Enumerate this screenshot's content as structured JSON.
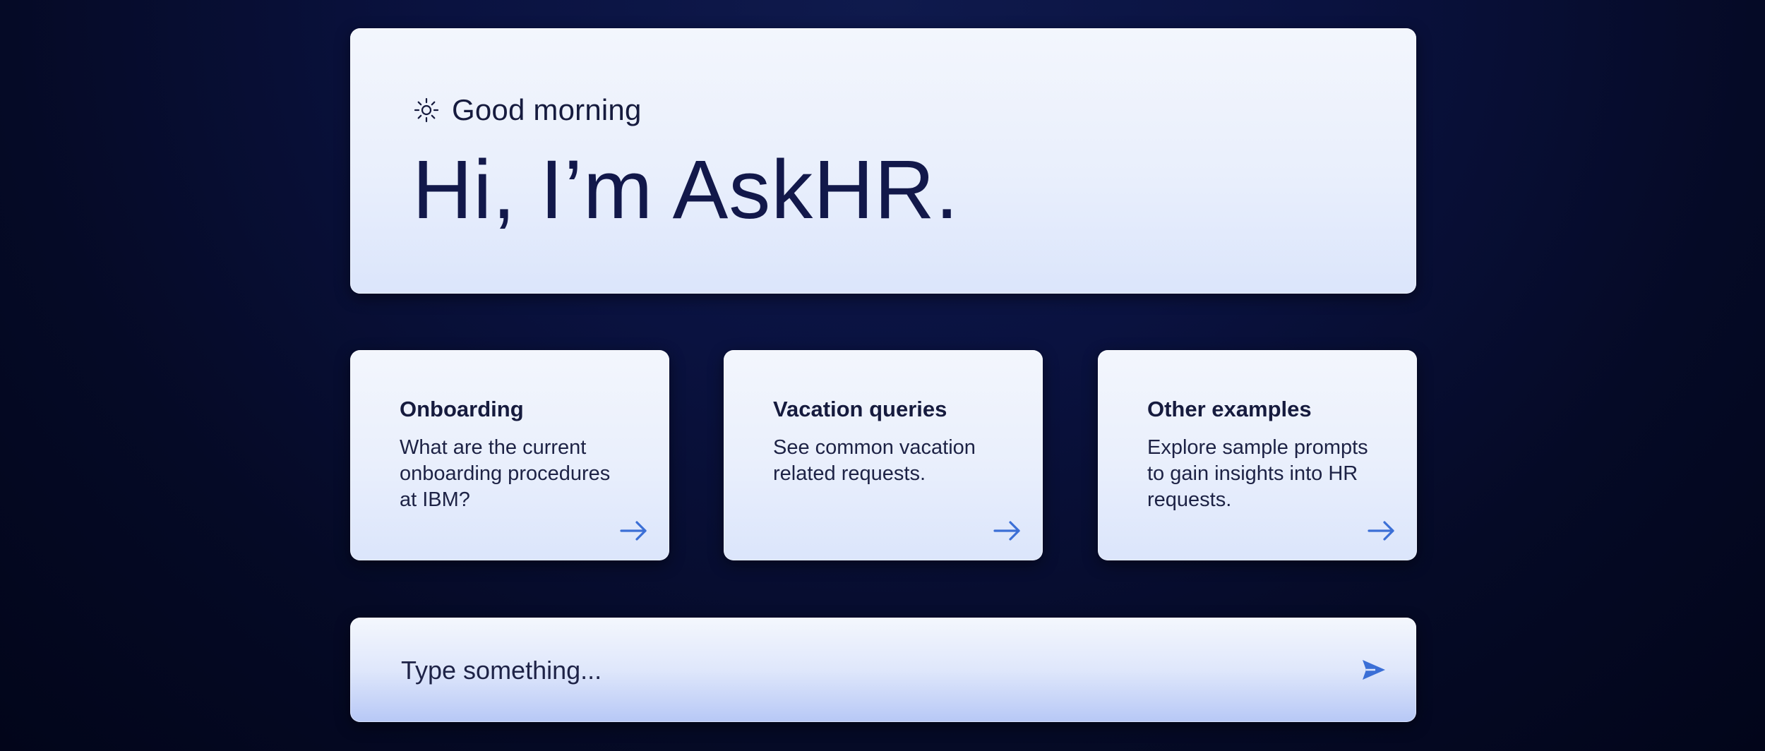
{
  "greeting": {
    "icon": "sun-icon",
    "text": "Good morning",
    "title": "Hi, I’m AskHR."
  },
  "cards": [
    {
      "title": "Onboarding",
      "description": "What are the current onboarding procedures at IBM?",
      "icon": "arrow-right-icon"
    },
    {
      "title": "Vacation queries",
      "description": "See common vacation related requests.",
      "icon": "arrow-right-icon"
    },
    {
      "title": "Other examples",
      "description": "Explore sample prompts to gain insights into HR requests.",
      "icon": "arrow-right-icon"
    }
  ],
  "input": {
    "placeholder": "Type something...",
    "value": "",
    "send_icon": "send-icon"
  },
  "colors": {
    "accent": "#3b6fd6",
    "text_dark": "#12184a",
    "background_top": "#0f1a4d",
    "background_bottom": "#02051a",
    "panel": "#eef2fc"
  }
}
